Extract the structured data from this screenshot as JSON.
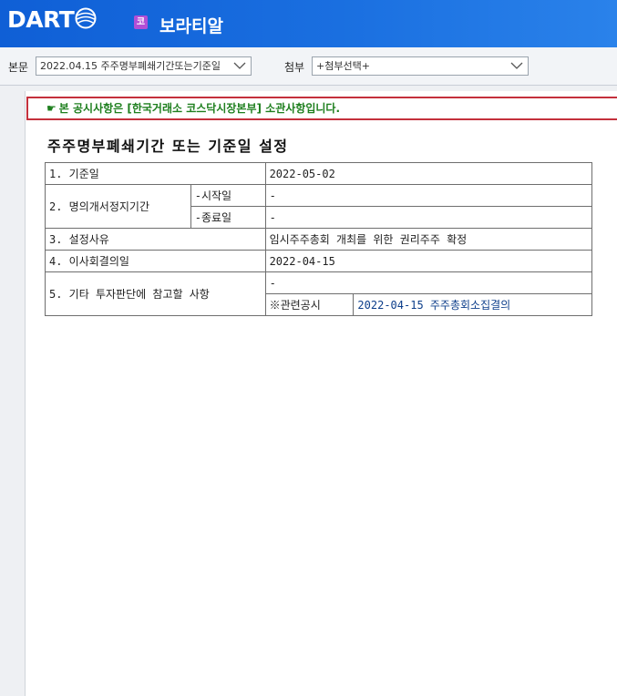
{
  "header": {
    "logo_text": "DART",
    "corp_badge": "코",
    "corp_name": "보라티알"
  },
  "toolbar": {
    "body_label": "본문",
    "body_select_value": "2022.04.15 주주명부폐쇄기간또는기준일",
    "attach_label": "첨부",
    "attach_select_value": "+첨부선택+"
  },
  "notice": {
    "icon": "pointing-hand-icon",
    "text": "본 공시사항은 [한국거래소 코스닥시장본부] 소관사항입니다."
  },
  "document": {
    "title": "주주명부폐쇄기간 또는 기준일 설정",
    "rows": {
      "r1_label": "1. 기준일",
      "r1_value": "2022-05-02",
      "r2_label": "2. 명의개서정지기간",
      "r2_start_label": "-시작일",
      "r2_start_value": "-",
      "r2_end_label": "-종료일",
      "r2_end_value": "-",
      "r3_label": "3. 설정사유",
      "r3_value": "임시주주총회 개최를 위한 권리주주 확정",
      "r4_label": "4. 이사회결의일",
      "r4_value": "2022-04-15",
      "r5_label": "5. 기타 투자판단에 참고할 사항",
      "r5_value": "-",
      "r5_related_label": "※관련공시",
      "r5_related_value": "2022-04-15 주주총회소집결의"
    }
  },
  "colors": {
    "header_blue": "#1a6fe0",
    "notice_border": "#c4303c",
    "notice_text": "#1e7f1e",
    "link": "#0b3d8a"
  }
}
